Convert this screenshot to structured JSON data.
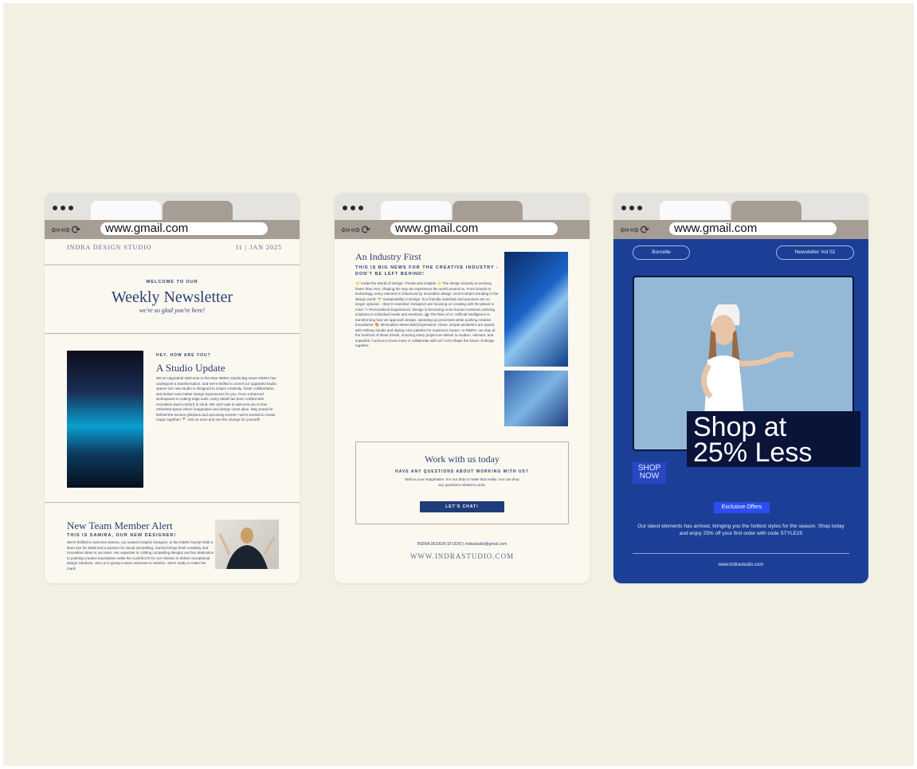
{
  "browser": {
    "url": "www.gmail.com"
  },
  "newsletter1": {
    "studio": "INDRA DESIGN STUDIO",
    "issue": "I1 | JAN 2025",
    "welcome": "WELCOME TO OUR",
    "title": "Weekly Newsletter",
    "script": "we're so glad you're here!",
    "hey": "HEY, HOW ARE YOU?",
    "update_title": "A Studio Update",
    "update_body": "We've Upgraded! Welcome to the New INDRA Studio Big news! INDRA has undergone a transformation, and we're thrilled to unveil our upgraded studio space! Our new studio is designed to inspire creativity, foster collaboration, and deliver even better design experiences for you. From enhanced workspaces to cutting-edge tools, every detail has been crafted with innovation (and comfort) in mind. We can't wait to welcome you to this refreshed space where imagination and design come alive. Stay tuned for behind-the-scenes glimpses and upcoming events—we're excited to create magic together! 📍 Visit us soon and see the change for yourself!",
    "team_title": "New Team Member Alert",
    "team_sub": "THIS IS SAMIRA, OUR NEW DESIGNER!",
    "team_body": "We're thrilled to welcome Samira, our newest Graphic Designer, to the INDRA family! With a keen eye for detail and a passion for visual storytelling, Samira brings fresh creativity and innovative ideas to our team. Her expertise in crafting compelling designs and her dedication to pushing creative boundaries make her a perfect fit for our mission to deliver exceptional design solutions. Join us in giving a warm welcome to Samira—she's ready to make her mark!"
  },
  "newsletter2": {
    "title": "An Industry First",
    "subtitle": "THIS IS BIG NEWS FOR THE CREATIVE INDUSTRY - DON'T BE LEFT BEHIND!",
    "body": "🌟 Inside the World of Design: Trends and Insights 🌟 The design industry is evolving faster than ever, shaping the way we experience the world around us. From brands to technology, every element is influenced by innovative design. Here's what's trending in the design world: 🌱 Sustainability in Design: Eco-friendly materials and practices are no longer optional – they're essential. Designers are focusing on creating with the planet in mind. ✎ Personalized Experiences: Design is becoming more human-centered, tailoring solutions to individual needs and emotions. 🤖 The Rise of AI: Artificial Intelligence is transforming how we approach design, speeding up processes while pushing creative boundaries. 🎨 Minimalism Meets Bold Expression: Clean, simple aesthetics are paired with striking visuals and daring color palettes for maximum impact. At INDRA, we stay at the forefront of these trends, ensuring every project we deliver is modern, relevant, and impactful. Curious to know more or collaborate with us? Let's shape the future of design together.",
    "work_title": "Work with us today",
    "work_question": "HAVE ANY QUESTIONS ABOUT WORKING WITH US?",
    "work_body": "Wall us your imagination. It is our duty to make that reality. You can drop any questions related to work.",
    "cta": "LET'S CHAT!",
    "footer_small": "INDRA DESIGN STUDIO | indrastudio@gmail.com",
    "footer_url": "WWW.INDRASTUDIO.COM"
  },
  "newsletter3": {
    "pill_left": "Borcelle",
    "pill_right": "Newsletter Vol 02",
    "headline_1": "Shop at",
    "headline_2": "25% Less",
    "shop_1": "SHOP",
    "shop_2": "NOW",
    "exclusive": "Exclusive Offers",
    "desc": "Our latest elements has arrived, bringing you the hottest styles for the season. Shop today and enjoy 25% off your first order with code STYLE25",
    "footer": "www.indrastudio.com"
  },
  "colors": {
    "canvas": "#f2f0e2",
    "navy": "#2a3f74",
    "promo_blue": "#1b3f97",
    "toolbar": "#a69d94"
  }
}
